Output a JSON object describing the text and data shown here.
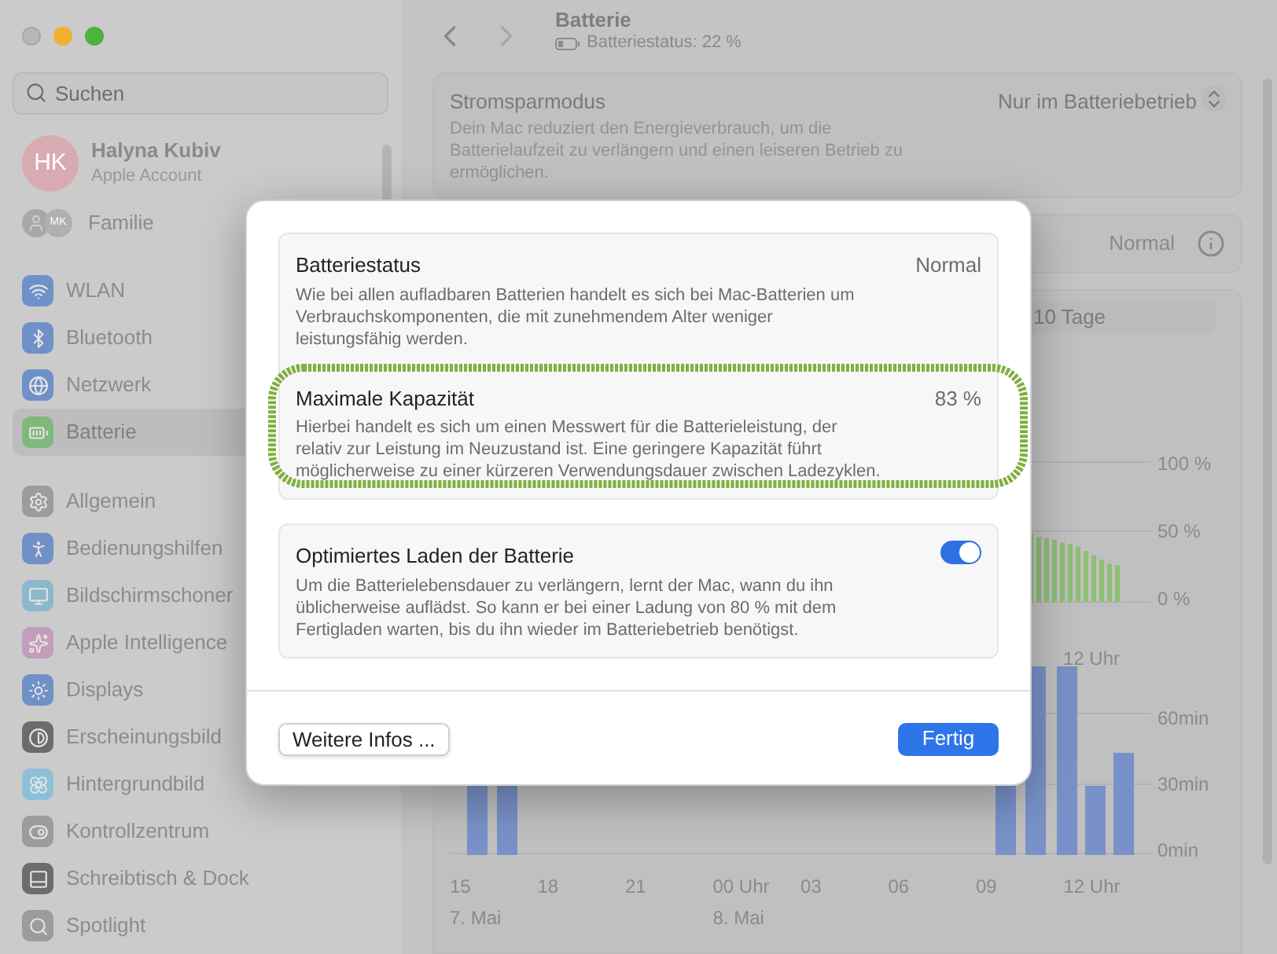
{
  "sidebar": {
    "search": {
      "placeholder": "Suchen"
    },
    "account": {
      "initials": "HK",
      "name": "Halyna Kubiv",
      "subtitle": "Apple Account"
    },
    "family": {
      "badge": "MK",
      "label": "Familie"
    },
    "groups": [
      [
        {
          "label": "WLAN",
          "color": "#7090c8",
          "selected": false
        },
        {
          "label": "Bluetooth",
          "color": "#7090c8",
          "selected": false
        },
        {
          "label": "Netzwerk",
          "color": "#7090c8",
          "selected": false
        },
        {
          "label": "Batterie",
          "color": "#80b87c",
          "selected": true
        }
      ],
      [
        {
          "label": "Allgemein",
          "color": "#9c9c9c",
          "selected": false
        },
        {
          "label": "Bedienungshilfen",
          "color": "#7090c8",
          "selected": false
        },
        {
          "label": "Bildschirmschoner",
          "color": "#8cb8cc",
          "selected": false
        },
        {
          "label": "Apple Intelligence",
          "color": "#c49cbc",
          "selected": false
        },
        {
          "label": "Displays",
          "color": "#7090c8",
          "selected": false
        },
        {
          "label": "Erscheinungsbild",
          "color": "#6c6c6c",
          "selected": false
        },
        {
          "label": "Hintergrundbild",
          "color": "#8cc0d8",
          "selected": false
        },
        {
          "label": "Kontrollzentrum",
          "color": "#9c9c9c",
          "selected": false
        },
        {
          "label": "Schreibtisch & Dock",
          "color": "#6c6c6c",
          "selected": false
        },
        {
          "label": "Spotlight",
          "color": "#9c9c9c",
          "selected": false
        }
      ]
    ]
  },
  "header": {
    "title": "Batterie",
    "subtitle": "Batteriestatus: 22 %"
  },
  "low_power": {
    "title": "Stromsparmodus",
    "description": "Dein Mac reduziert den Energieverbrauch, um die Batterielaufzeit zu verlängern und einen leiseren Betrieb zu ermöglichen.",
    "value": "Nur im Batteriebetrieb"
  },
  "health_row": {
    "value": "Normal"
  },
  "range_control": {
    "label": "10 Tage"
  },
  "level_chart": {
    "y_labels": [
      "100 %",
      "50 %",
      "0 %"
    ],
    "x_labels": [
      "12 Uhr"
    ]
  },
  "usage_chart": {
    "y_labels": [
      "60min",
      "30min",
      "0min"
    ],
    "x_labels": [
      {
        "label": "15",
        "date": "7. Mai"
      },
      {
        "label": "18"
      },
      {
        "label": "21"
      },
      {
        "label": "00 Uhr",
        "date": "8. Mai"
      },
      {
        "label": "03"
      },
      {
        "label": "06"
      },
      {
        "label": "09"
      },
      {
        "label": "12 Uhr"
      }
    ]
  },
  "dialog": {
    "groups": [
      [
        {
          "kind": "value",
          "title": "Batteriestatus",
          "description": "Wie bei allen aufladbaren Batterien handelt es sich bei Mac-Batterien um Verbrauchskomponenten, die mit zunehmendem Alter weniger leistungsfähig werden.",
          "value": "Normal",
          "highlighted": false
        },
        {
          "kind": "value",
          "title": "Maximale Kapazität",
          "description": "Hierbei handelt es sich um einen Messwert für die Batterieleistung, der relativ zur Leistung im Neuzustand ist. Eine geringere Kapazität führt möglicherweise zu einer kürzeren Verwendungsdauer zwischen Ladezyklen.",
          "value": "83 %",
          "highlighted": true
        }
      ],
      [
        {
          "kind": "toggle",
          "title": "Optimiertes Laden der Batterie",
          "description": "Um die Batterielebensdauer zu verlängern, lernt der Mac, wann du ihn üblicherweise auflädst. So kann er bei einer Ladung von 80 % mit dem Fertigladen warten, bis du ihn wieder im Batteriebetrieb benötigst.",
          "on": true,
          "highlighted": false
        }
      ]
    ],
    "buttons": [
      {
        "label": "Weitere Infos ...",
        "primary": false
      },
      {
        "label": "Fertig",
        "primary": true
      }
    ]
  }
}
